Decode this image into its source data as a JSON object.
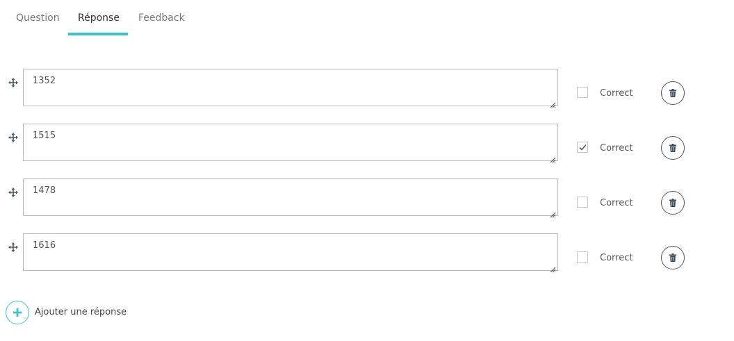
{
  "tabs": [
    {
      "label": "Question",
      "active": false
    },
    {
      "label": "Réponse",
      "active": true
    },
    {
      "label": "Feedback",
      "active": false
    }
  ],
  "accent_color": "#3cc2c8",
  "answers": [
    {
      "text": "1352",
      "correct": false,
      "correct_label": "Correct"
    },
    {
      "text": "1515",
      "correct": true,
      "correct_label": "Correct"
    },
    {
      "text": "1478",
      "correct": false,
      "correct_label": "Correct"
    },
    {
      "text": "1616",
      "correct": false,
      "correct_label": "Correct"
    }
  ],
  "add_answer_label": "Ajouter une réponse",
  "icons": {
    "drag": "move-arrows-icon",
    "delete": "trash-icon",
    "add": "plus-icon",
    "check": "checkmark-icon",
    "resize": "resize-grip-icon"
  }
}
